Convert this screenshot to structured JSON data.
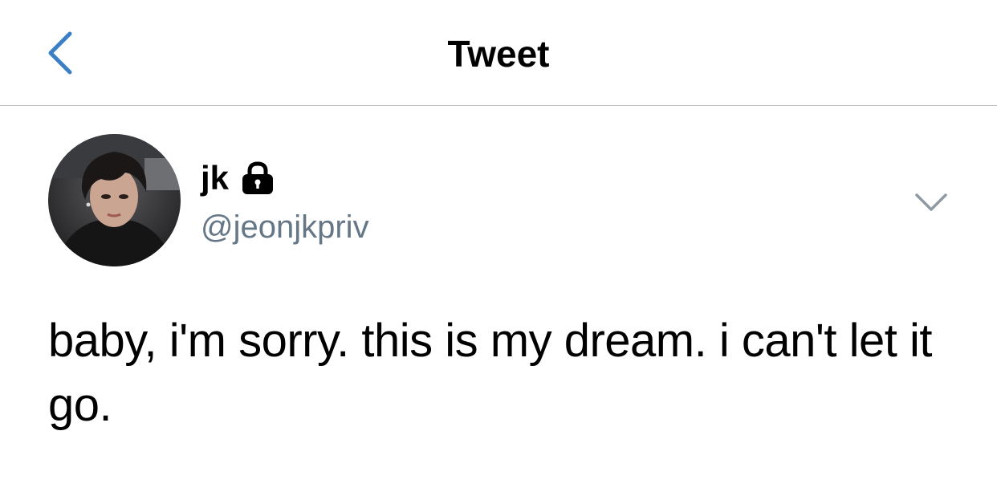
{
  "header": {
    "title": "Tweet",
    "back_icon": "chevron-left-icon"
  },
  "tweet": {
    "author": {
      "display_name": "jk",
      "handle": "@jeonjkpriv",
      "protected_icon": "lock-icon",
      "avatar": "profile-photo"
    },
    "more_icon": "chevron-down-icon",
    "text": "baby, i'm sorry. this is my dream. i can't let it go."
  },
  "colors": {
    "accent": "#3b7fc4",
    "text_primary": "#000000",
    "text_secondary": "#657786",
    "divider": "#bdc3c7",
    "background": "#ffffff"
  }
}
